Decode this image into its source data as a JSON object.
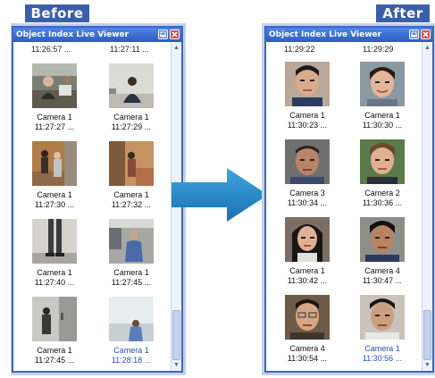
{
  "captions": {
    "before": "Before",
    "after": "After"
  },
  "before_window": {
    "title": "Object Index Live Viewer",
    "top_times": [
      "11:26:57 ...",
      "11:27:11 ..."
    ],
    "items": [
      {
        "camera": "Camera 1",
        "time": "11:27:27 ...",
        "thumb": "office-people-icon"
      },
      {
        "camera": "Camera 1",
        "time": "11:27:29 ...",
        "thumb": "person-seated-icon"
      },
      {
        "camera": "Camera 1",
        "time": "11:27:30 ...",
        "thumb": "hallway-people-icon"
      },
      {
        "camera": "Camera 1",
        "time": "11:27:32 ...",
        "thumb": "doorway-person-icon"
      },
      {
        "camera": "Camera 1",
        "time": "11:27:40 ...",
        "thumb": "legs-icon"
      },
      {
        "camera": "Camera 1",
        "time": "11:27:45 ...",
        "thumb": "person-standing-icon"
      },
      {
        "camera": "Camera 1",
        "time": "11:27:45 ...",
        "thumb": "door-person-icon"
      },
      {
        "camera": "Camera 1",
        "time": "11:28:18 ...",
        "thumb": "bright-person-icon"
      }
    ]
  },
  "after_window": {
    "title": "Object Index Live Viewer",
    "top_times": [
      "11:29:22",
      "11:29:29"
    ],
    "items": [
      {
        "camera": "Camera 1",
        "time": "11:30:23 ...",
        "thumb": "face-icon"
      },
      {
        "camera": "Camera 1",
        "time": "11:30:30 ...",
        "thumb": "face-icon"
      },
      {
        "camera": "Camera 3",
        "time": "11:30:34 ...",
        "thumb": "face-icon"
      },
      {
        "camera": "Camera 2",
        "time": "11:30:36 ...",
        "thumb": "face-icon"
      },
      {
        "camera": "Camera 1",
        "time": "11:30:42 ...",
        "thumb": "face-icon"
      },
      {
        "camera": "Camera 4",
        "time": "11:30:47 ...",
        "thumb": "face-icon"
      },
      {
        "camera": "Camera 4",
        "time": "11:30:54 ...",
        "thumb": "face-icon"
      },
      {
        "camera": "Camera 1",
        "time": "11:30:56 ...",
        "thumb": "face-icon"
      }
    ]
  },
  "colors": {
    "accent": "#3b5fa6",
    "titlebar": "#2d5cc2",
    "arrow": "#2a86c8",
    "selected_text": "#2c4fb0"
  }
}
